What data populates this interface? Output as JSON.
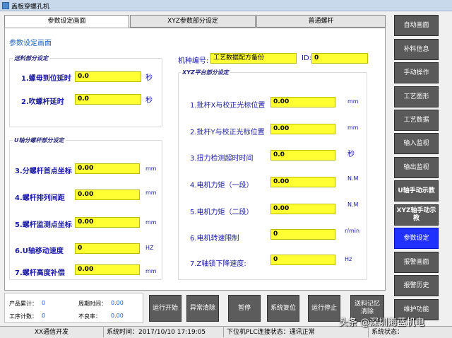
{
  "window": {
    "title": "盖板穿螺孔机"
  },
  "tabs": [
    {
      "label": "参数设定画面",
      "active": true
    },
    {
      "label": "XYZ参数部分设定",
      "active": false
    },
    {
      "label": "普通螺杆",
      "active": false
    }
  ],
  "page_title": "参数设定画面",
  "feed_group": {
    "title": "送料部分设定",
    "fields": [
      {
        "label": "1.螺母到位延时",
        "value": "0.0",
        "unit": "秒"
      },
      {
        "label": "2.吹螺杆延时",
        "value": "0.0",
        "unit": "秒"
      }
    ]
  },
  "u_group": {
    "title": "U轴分螺杆部分设定",
    "fields": [
      {
        "label": "3.分螺杆首点坐标",
        "value": "0.00",
        "unit": "mm"
      },
      {
        "label": "4.螺杆排列间距",
        "value": "0.00",
        "unit": "mm"
      },
      {
        "label": "5.螺杆监测点坐标",
        "value": "0.00",
        "unit": "mm"
      },
      {
        "label": "6.U轴移动速度",
        "value": "0",
        "unit": "HZ"
      },
      {
        "label": "7.螺杆高度补偿",
        "value": "0.00",
        "unit": "mm"
      }
    ]
  },
  "model": {
    "label": "机种编号:",
    "value": "工艺数据配方备份",
    "id_label": "ID:",
    "id_value": "0"
  },
  "xyz_group": {
    "title": "XYZ平台部分设定",
    "fields": [
      {
        "label": "1.批杆X与校正光标位置",
        "value": "0.00",
        "unit": "mm"
      },
      {
        "label": "2.批杆Y与校正光标位置",
        "value": "0.00",
        "unit": "mm"
      },
      {
        "label": "3.扭力检测超时时间",
        "value": "0.0",
        "unit": "秒"
      },
      {
        "label": "4.电机力矩（一段）",
        "value": "0.00",
        "unit": "N.M"
      },
      {
        "label": "5.电机力矩（二段）",
        "value": "0.00",
        "unit": "N.M"
      },
      {
        "label": "6.电机转速限制",
        "value": "0",
        "unit": "r/min"
      },
      {
        "label": "7.Z轴锁下降速度:",
        "value": "0",
        "unit": "Hz"
      }
    ]
  },
  "stats": {
    "product_total_label": "产品累计：",
    "product_total": "0",
    "cycle_time_label": "周期时间：",
    "cycle_time": "0.00",
    "work_count_label": "工序计数：",
    "work_count": "0",
    "defect_rate_label": "不良率：",
    "defect_rate": "0.00"
  },
  "actions": [
    {
      "label": "运行开始"
    },
    {
      "label": "异常清除"
    },
    {
      "label": "暂停"
    },
    {
      "label": "系统复位"
    },
    {
      "label": "运行停止"
    },
    {
      "label": "送料记忆清除"
    }
  ],
  "side_menu": [
    {
      "label": "自动画面"
    },
    {
      "label": "补料信息"
    },
    {
      "label": "手动操作"
    },
    {
      "label": "工艺图形"
    },
    {
      "label": "工艺数据"
    },
    {
      "label": "输入监视"
    },
    {
      "label": "输出监视"
    },
    {
      "label": "U轴手动示教"
    },
    {
      "label": "XYZ轴手动示教"
    },
    {
      "label": "参数设定"
    },
    {
      "label": "报警画面"
    },
    {
      "label": "报警历史"
    },
    {
      "label": "维护功能"
    }
  ],
  "statusbar": {
    "comm": "XX通信开发",
    "system_time": "系统时间：2017/10/10 17:19:05",
    "plc_status": "下位机PLC连接状态：通讯正常",
    "sys_status": "系统状态："
  },
  "watermark": "头条 @深圳海蓝机电",
  "colors": {
    "input_bg": "#ffff33",
    "label_blue": "#1a1aa0",
    "active_button": "#2030ff",
    "button_gray": "#5a5a5a"
  }
}
